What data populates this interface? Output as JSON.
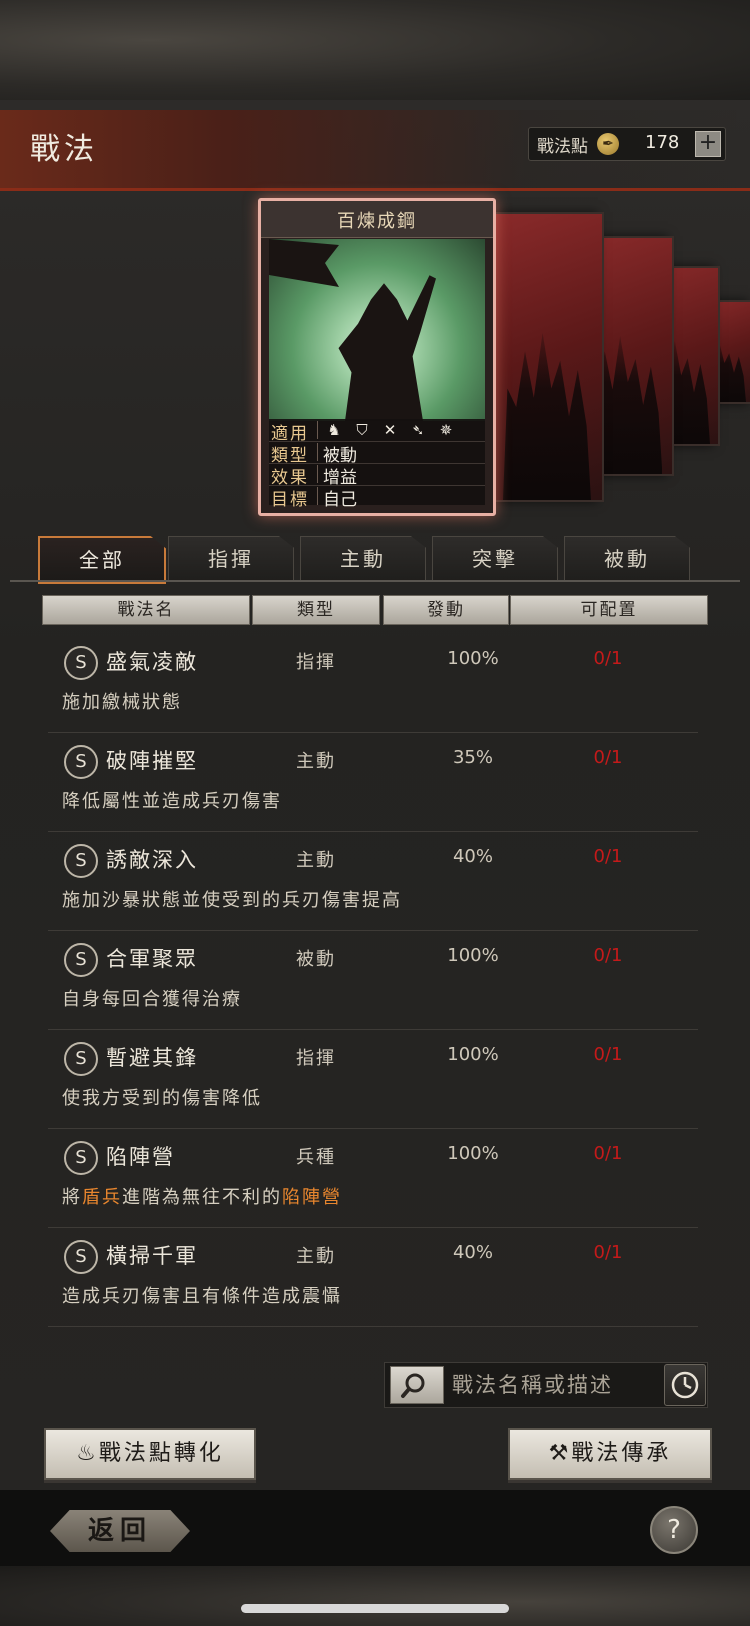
{
  "header": {
    "title": "戰法",
    "points_label": "戰法點",
    "points_icon": "quill-coin-icon",
    "points_value": "178",
    "add_symbol": "+"
  },
  "featured_card": {
    "name": "百煉成鋼",
    "rows": [
      {
        "key": "適用",
        "value": ""
      },
      {
        "key": "類型",
        "value": "被動"
      },
      {
        "key": "效果",
        "value": "增益"
      },
      {
        "key": "目標",
        "value": "自己"
      }
    ],
    "applicable_icons": [
      "cavalry-icon",
      "shield-icon",
      "bow-icon",
      "spear-icon",
      "siege-icon"
    ]
  },
  "tabs": [
    {
      "label": "全部",
      "active": true
    },
    {
      "label": "指揮",
      "active": false
    },
    {
      "label": "主動",
      "active": false
    },
    {
      "label": "突擊",
      "active": false
    },
    {
      "label": "被動",
      "active": false
    }
  ],
  "columns": [
    "戰法名",
    "類型",
    "發動",
    "可配置"
  ],
  "rows": [
    {
      "grade": "S",
      "name": "盛氣凌敵",
      "type": "指揮",
      "rate": "100%",
      "slots": "0/1",
      "desc": "施加繳械狀態"
    },
    {
      "grade": "S",
      "name": "破陣摧堅",
      "type": "主動",
      "rate": "35%",
      "slots": "0/1",
      "desc": "降低屬性並造成兵刃傷害"
    },
    {
      "grade": "S",
      "name": "誘敵深入",
      "type": "主動",
      "rate": "40%",
      "slots": "0/1",
      "desc": "施加沙暴狀態並使受到的兵刃傷害提高"
    },
    {
      "grade": "S",
      "name": "合軍聚眾",
      "type": "被動",
      "rate": "100%",
      "slots": "0/1",
      "desc": "自身每回合獲得治療"
    },
    {
      "grade": "S",
      "name": "暫避其鋒",
      "type": "指揮",
      "rate": "100%",
      "slots": "0/1",
      "desc": "使我方受到的傷害降低"
    },
    {
      "grade": "S",
      "name": "陷陣營",
      "type": "兵種",
      "rate": "100%",
      "slots": "0/1",
      "desc_parts": [
        "將",
        "盾兵",
        "進階為無往不利的",
        "陷陣營"
      ]
    },
    {
      "grade": "S",
      "name": "橫掃千軍",
      "type": "主動",
      "rate": "40%",
      "slots": "0/1",
      "desc": "造成兵刃傷害且有條件造成震懾"
    }
  ],
  "search": {
    "placeholder": "戰法名稱或描述",
    "value": ""
  },
  "buttons": {
    "convert": "戰法點轉化",
    "inherit": "戰法傳承",
    "back": "返回",
    "help": "?"
  },
  "colors": {
    "accent": "#c87a3a",
    "slots_red": "#c41a1a",
    "highlight_orange": "#e8862e"
  }
}
